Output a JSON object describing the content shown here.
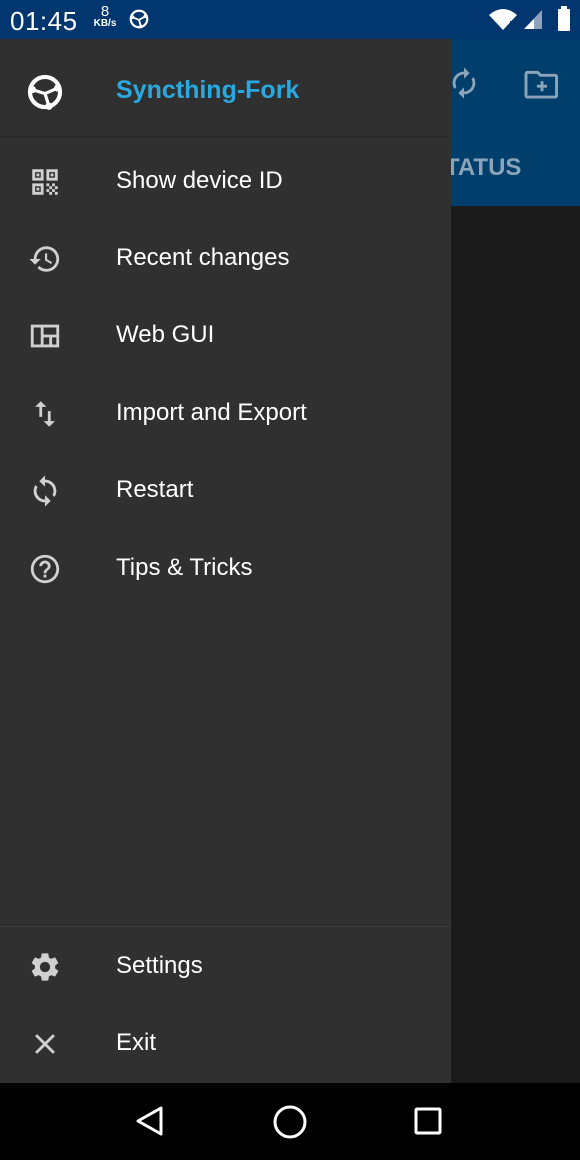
{
  "status_bar": {
    "time": "01:45",
    "net_speed_value": "8",
    "net_speed_unit": "KB/s",
    "icons": [
      "syncthing-notification-icon",
      "wifi-icon",
      "cell-signal-icon",
      "battery-icon"
    ]
  },
  "background_app": {
    "tab_label": "TATUS",
    "toolbar_icons": [
      "refresh-icon",
      "add-folder-icon"
    ],
    "toolbar_color": "#003e6b"
  },
  "drawer": {
    "app_name": "Syncthing-Fork",
    "app_name_color": "#29a9e0",
    "menu_items": [
      {
        "label": "Show device ID",
        "icon": "qr-code-icon"
      },
      {
        "label": "Recent changes",
        "icon": "history-icon"
      },
      {
        "label": "Web GUI",
        "icon": "web-dashboard-icon"
      },
      {
        "label": "Import and Export",
        "icon": "import-export-icon"
      },
      {
        "label": "Restart",
        "icon": "restart-icon"
      },
      {
        "label": "Tips & Tricks",
        "icon": "help-icon"
      }
    ],
    "footer_items": [
      {
        "label": "Settings",
        "icon": "gear-icon"
      },
      {
        "label": "Exit",
        "icon": "close-icon"
      }
    ]
  },
  "nav_bar": {
    "icons": [
      "back-icon",
      "home-icon",
      "recents-icon"
    ]
  }
}
